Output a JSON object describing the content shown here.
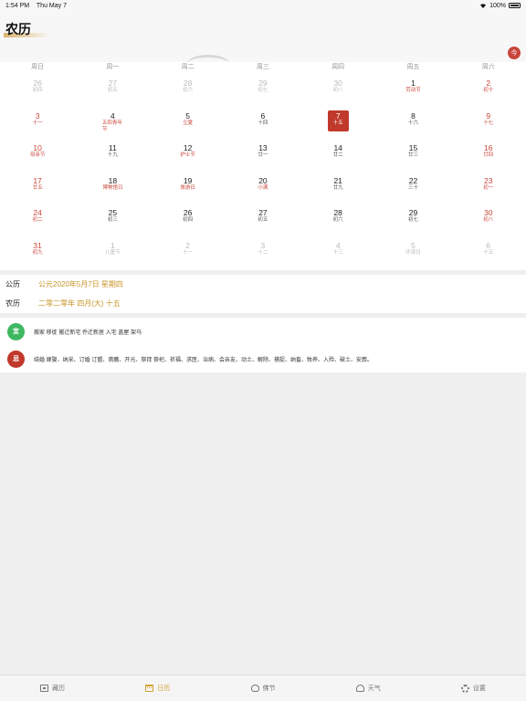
{
  "status_bar": {
    "time": "1:54 PM",
    "date": "Thu May 7",
    "battery": "100%"
  },
  "header": {
    "title": "农历",
    "today_label": "今"
  },
  "weekdays": [
    "周日",
    "周一",
    "周二",
    "周三",
    "周四",
    "周五",
    "周六"
  ],
  "days": [
    {
      "n": "26",
      "l": "初四",
      "t": "other"
    },
    {
      "n": "27",
      "l": "初五",
      "t": "other"
    },
    {
      "n": "28",
      "l": "初六",
      "t": "other"
    },
    {
      "n": "29",
      "l": "初七",
      "t": "other"
    },
    {
      "n": "30",
      "l": "初八",
      "t": "other"
    },
    {
      "n": "1",
      "l": "劳动节",
      "t": "festival"
    },
    {
      "n": "2",
      "l": "初十",
      "t": "weekend"
    },
    {
      "n": "3",
      "l": "十一",
      "t": "weekend"
    },
    {
      "n": "4",
      "l": "五四青年节",
      "t": "festival"
    },
    {
      "n": "5",
      "l": "立夏",
      "t": "festival"
    },
    {
      "n": "6",
      "l": "十四",
      "t": ""
    },
    {
      "n": "7",
      "l": "十五",
      "t": "today"
    },
    {
      "n": "8",
      "l": "十六",
      "t": ""
    },
    {
      "n": "9",
      "l": "十七",
      "t": "weekend"
    },
    {
      "n": "10",
      "l": "母亲节",
      "t": "weekend"
    },
    {
      "n": "11",
      "l": "十九",
      "t": ""
    },
    {
      "n": "12",
      "l": "护士节",
      "t": "festival"
    },
    {
      "n": "13",
      "l": "廿一",
      "t": ""
    },
    {
      "n": "14",
      "l": "廿二",
      "t": ""
    },
    {
      "n": "15",
      "l": "廿三",
      "t": ""
    },
    {
      "n": "16",
      "l": "廿四",
      "t": "weekend"
    },
    {
      "n": "17",
      "l": "廿五",
      "t": "weekend"
    },
    {
      "n": "18",
      "l": "博物馆日",
      "t": "festival"
    },
    {
      "n": "19",
      "l": "旅游日",
      "t": "festival"
    },
    {
      "n": "20",
      "l": "小满",
      "t": "festival"
    },
    {
      "n": "21",
      "l": "廿九",
      "t": ""
    },
    {
      "n": "22",
      "l": "三十",
      "t": ""
    },
    {
      "n": "23",
      "l": "初一",
      "t": "weekend"
    },
    {
      "n": "24",
      "l": "初二",
      "t": "weekend"
    },
    {
      "n": "25",
      "l": "初三",
      "t": ""
    },
    {
      "n": "26",
      "l": "初四",
      "t": ""
    },
    {
      "n": "27",
      "l": "初五",
      "t": ""
    },
    {
      "n": "28",
      "l": "初六",
      "t": ""
    },
    {
      "n": "29",
      "l": "初七",
      "t": ""
    },
    {
      "n": "30",
      "l": "初八",
      "t": "weekend"
    },
    {
      "n": "31",
      "l": "初九",
      "t": "weekend"
    },
    {
      "n": "1",
      "l": "儿童节",
      "t": "other festival"
    },
    {
      "n": "2",
      "l": "十一",
      "t": "other"
    },
    {
      "n": "3",
      "l": "十二",
      "t": "other"
    },
    {
      "n": "4",
      "l": "十三",
      "t": "other"
    },
    {
      "n": "5",
      "l": "环境日",
      "t": "other festival"
    },
    {
      "n": "6",
      "l": "十五",
      "t": "other"
    }
  ],
  "info": {
    "solar_label": "公历",
    "solar_value": "公元2020年5月7日 星期四",
    "lunar_label": "农历",
    "lunar_value": "二零二零年 四月(大) 十五"
  },
  "advice": {
    "yi_label": "宜",
    "yi_text": "搬家 移徙 搬迁新宅 乔迁新居 入宅 盖屋 架马",
    "ji_label": "忌",
    "ji_text": "结婚 嫁娶、纳采、订婚 订盟、斋醮、开光、祭拜 祭祀、祈福、求医、治病、会亲友、动土、解除、捕捉、纳畜、牧养、入殓、破土、安葬。"
  },
  "tabs": [
    {
      "label": "藏历",
      "icon": "box-icon"
    },
    {
      "label": "日历",
      "icon": "calendar-icon"
    },
    {
      "label": "佛节",
      "icon": "buddha-icon"
    },
    {
      "label": "天气",
      "icon": "weather-icon"
    },
    {
      "label": "设置",
      "icon": "gear-icon"
    }
  ],
  "colors": {
    "accent": "#d4a030",
    "red": "#c0392b",
    "green": "#3fb862"
  }
}
